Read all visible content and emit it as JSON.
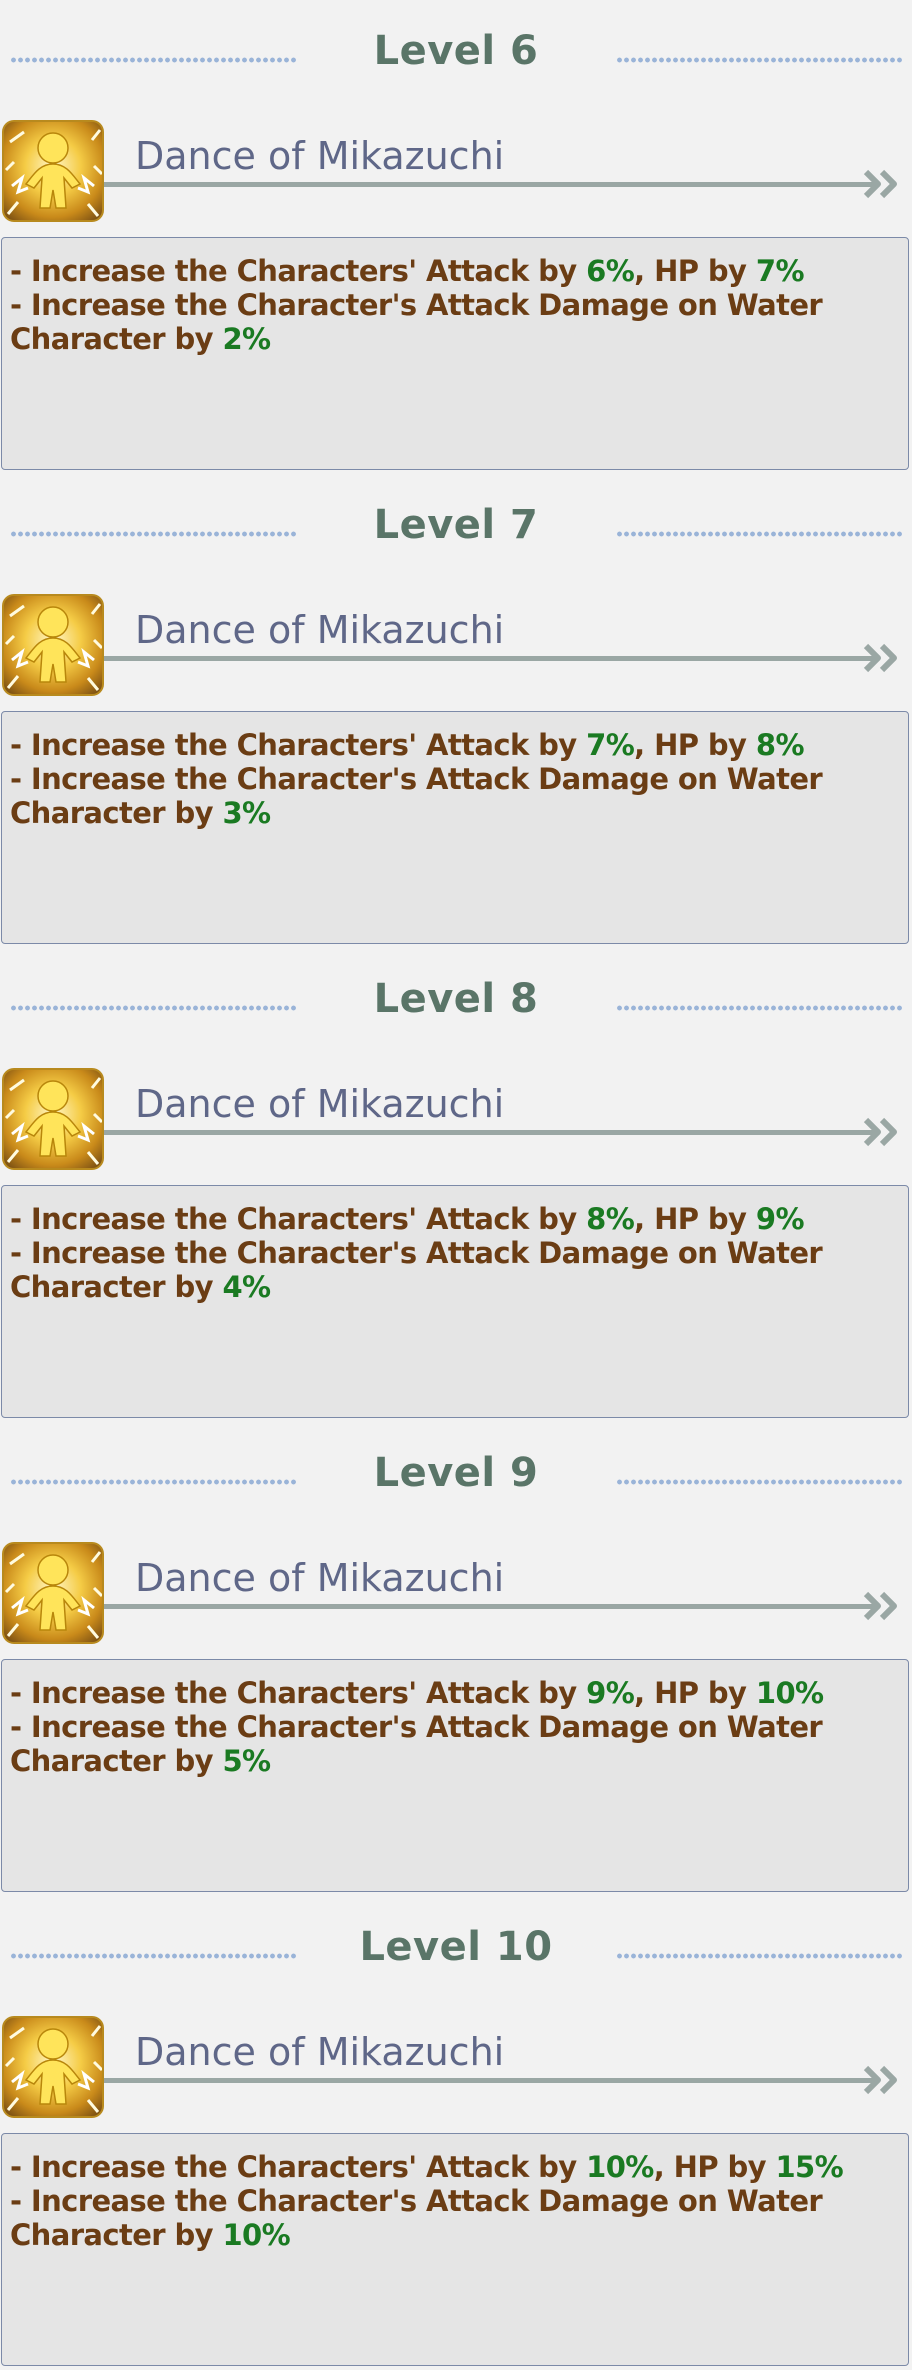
{
  "levels": [
    {
      "title": "Level 6",
      "skill_name": "Dance of Mikazuchi",
      "line1_pre": "- Increase the Characters' Attack by ",
      "atk": "6%",
      "line1_mid": ", HP by ",
      "hp": "7%",
      "line2": "- Increase the Character's Attack Damage on Water",
      "line3_pre": "Character by ",
      "dmg": "2%"
    },
    {
      "title": "Level 7",
      "skill_name": "Dance of Mikazuchi",
      "line1_pre": "- Increase the Characters' Attack by ",
      "atk": "7%",
      "line1_mid": ", HP by ",
      "hp": "8%",
      "line2": "- Increase the Character's Attack Damage on Water",
      "line3_pre": "Character by ",
      "dmg": "3%"
    },
    {
      "title": "Level 8",
      "skill_name": "Dance of Mikazuchi",
      "line1_pre": "- Increase the Characters' Attack by ",
      "atk": "8%",
      "line1_mid": ", HP by ",
      "hp": "9%",
      "line2": "- Increase the Character's Attack Damage on Water",
      "line3_pre": "Character by ",
      "dmg": "4%"
    },
    {
      "title": "Level 9",
      "skill_name": "Dance of Mikazuchi",
      "line1_pre": "- Increase the Characters' Attack by ",
      "atk": "9%",
      "line1_mid": ", HP by ",
      "hp": "10%",
      "line2": "- Increase the Character's Attack Damage on Water",
      "line3_pre": "Character by ",
      "dmg": "5%"
    },
    {
      "title": "Level 10",
      "skill_name": "Dance of Mikazuchi",
      "line1_pre": "- Increase the Characters' Attack by ",
      "atk": "10%",
      "line1_mid": ", HP by ",
      "hp": "15%",
      "line2": "- Increase the Character's Attack Damage on Water",
      "line3_pre": "Character by ",
      "dmg": "10%"
    }
  ],
  "icons": {
    "skill": "golden-figure-icon",
    "expand": "double-chevron-right-icon"
  },
  "colors": {
    "level_title": "#5a7568",
    "skill_name": "#5f6788",
    "desc_text": "#6b3d14",
    "highlight": "#1a7a22"
  }
}
